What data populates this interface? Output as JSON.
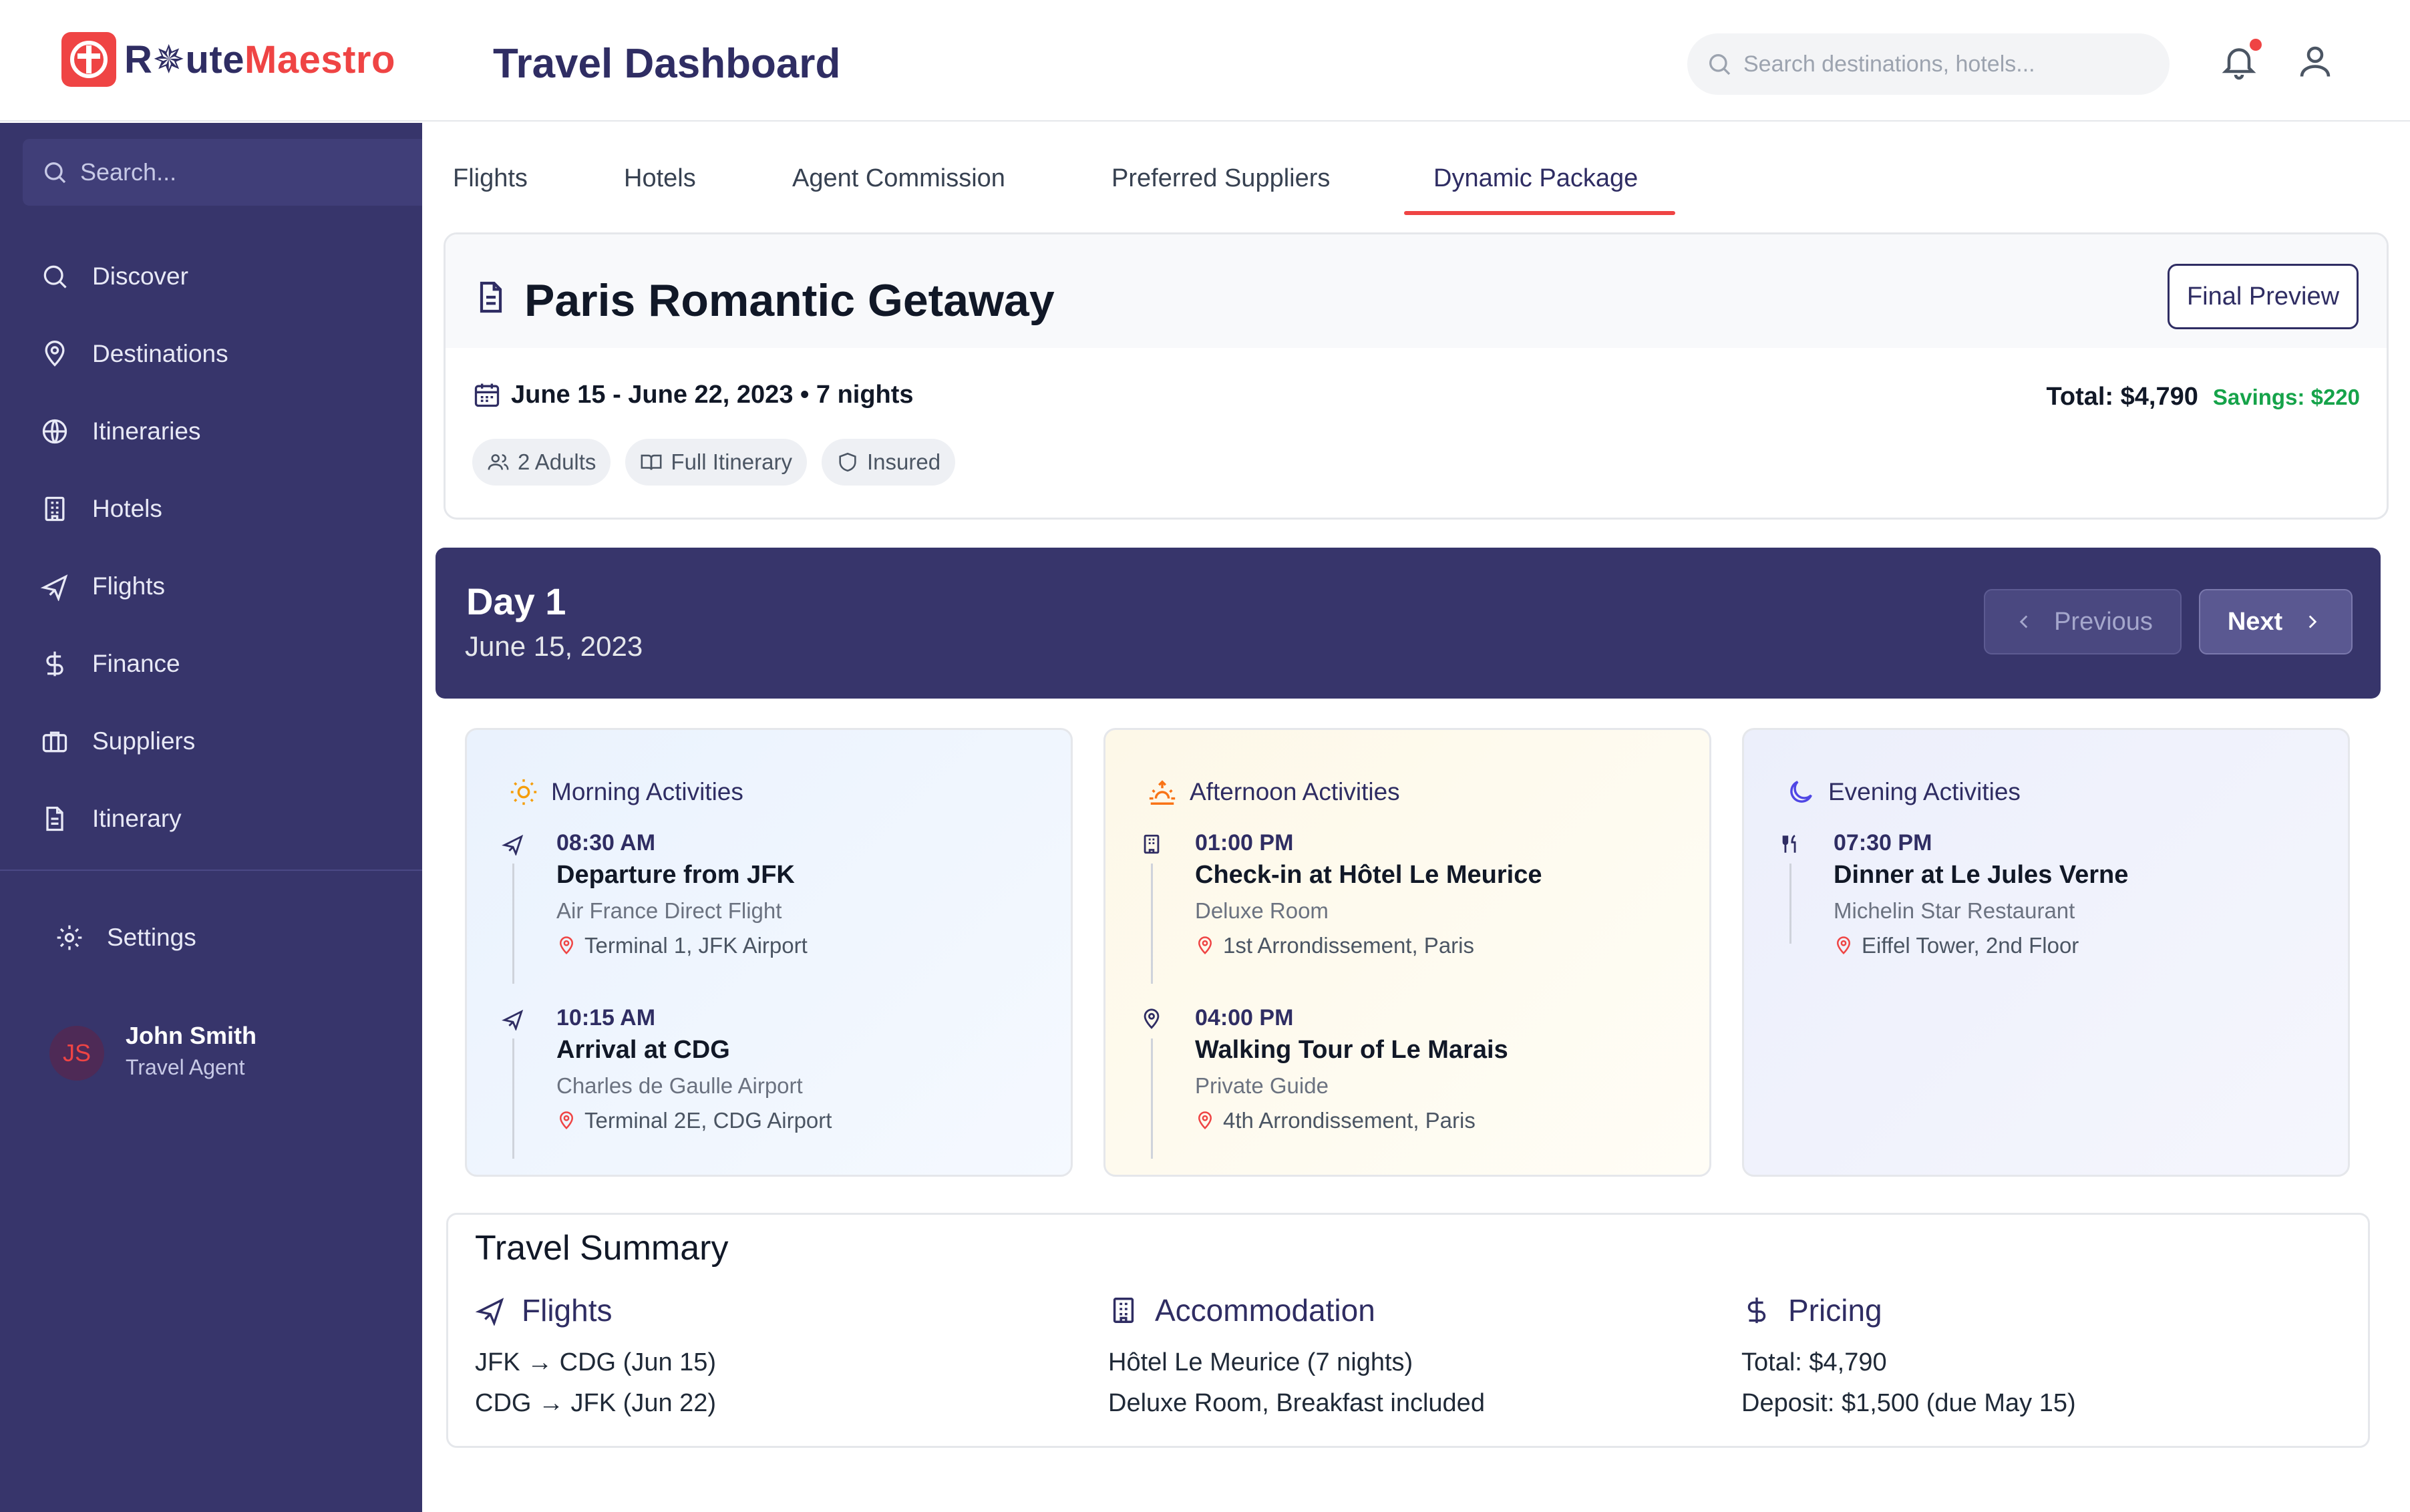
{
  "header": {
    "logo_prefix": "R",
    "logo_mid": "ute",
    "logo_suffix": "Maestro",
    "title": "Travel Dashboard",
    "search_placeholder": "Search destinations, hotels..."
  },
  "sidebar": {
    "search_placeholder": "Search...",
    "items": [
      {
        "label": "Discover",
        "icon": "search-icon"
      },
      {
        "label": "Destinations",
        "icon": "map-pin-icon"
      },
      {
        "label": "Itineraries",
        "icon": "globe-icon"
      },
      {
        "label": "Hotels",
        "icon": "building-icon"
      },
      {
        "label": "Flights",
        "icon": "plane-icon"
      },
      {
        "label": "Finance",
        "icon": "dollar-icon"
      },
      {
        "label": "Suppliers",
        "icon": "briefcase-icon"
      },
      {
        "label": "Itinerary",
        "icon": "document-icon"
      }
    ],
    "settings_label": "Settings",
    "user": {
      "initials": "JS",
      "name": "John Smith",
      "role": "Travel Agent"
    }
  },
  "tabs": [
    {
      "label": "Flights",
      "active": false
    },
    {
      "label": "Hotels",
      "active": false
    },
    {
      "label": "Agent Commission",
      "active": false
    },
    {
      "label": "Preferred Suppliers",
      "active": false
    },
    {
      "label": "Dynamic Package",
      "active": true
    }
  ],
  "package": {
    "title": "Paris Romantic Getaway",
    "final_preview_label": "Final Preview",
    "dates": "June 15 - June 22, 2023 • 7 nights",
    "total": "Total: $4,790",
    "savings": "Savings: $220",
    "chips": [
      {
        "label": "2 Adults",
        "icon": "users-icon"
      },
      {
        "label": "Full Itinerary",
        "icon": "book-icon"
      },
      {
        "label": "Insured",
        "icon": "shield-icon"
      }
    ]
  },
  "day": {
    "title": "Day 1",
    "date": "June 15, 2023",
    "previous_label": "Previous",
    "next_label": "Next"
  },
  "activities": {
    "morning": {
      "heading": "Morning Activities",
      "items": [
        {
          "time": "08:30 AM",
          "title": "Departure from JFK",
          "subtitle": "Air France Direct Flight",
          "location": "Terminal 1, JFK Airport",
          "icon": "plane-icon"
        },
        {
          "time": "10:15 AM",
          "title": "Arrival at CDG",
          "subtitle": "Charles de Gaulle Airport",
          "location": "Terminal 2E, CDG Airport",
          "icon": "plane-icon"
        }
      ]
    },
    "afternoon": {
      "heading": "Afternoon Activities",
      "items": [
        {
          "time": "01:00 PM",
          "title": "Check-in at Hôtel Le Meurice",
          "subtitle": "Deluxe Room",
          "location": "1st Arrondissement, Paris",
          "icon": "hotel-icon"
        },
        {
          "time": "04:00 PM",
          "title": "Walking Tour of Le Marais",
          "subtitle": "Private Guide",
          "location": "4th Arrondissement, Paris",
          "icon": "map-pin-icon"
        }
      ]
    },
    "evening": {
      "heading": "Evening Activities",
      "items": [
        {
          "time": "07:30 PM",
          "title": "Dinner at Le Jules Verne",
          "subtitle": "Michelin Star Restaurant",
          "location": "Eiffel Tower, 2nd Floor",
          "icon": "utensils-icon"
        }
      ]
    }
  },
  "summary": {
    "title": "Travel Summary",
    "flights": {
      "heading": "Flights",
      "lines": [
        "JFK → CDG (Jun 15)",
        "CDG → JFK (Jun 22)"
      ]
    },
    "accommodation": {
      "heading": "Accommodation",
      "lines": [
        "Hôtel Le Meurice (7 nights)",
        "Deluxe Room, Breakfast included"
      ]
    },
    "pricing": {
      "heading": "Pricing",
      "lines": [
        "Total: $4,790",
        "Deposit: $1,500 (due May 15)"
      ]
    }
  },
  "colors": {
    "brand_red": "#ef4444",
    "navy": "#37356b",
    "savings_green": "#16a34a"
  }
}
